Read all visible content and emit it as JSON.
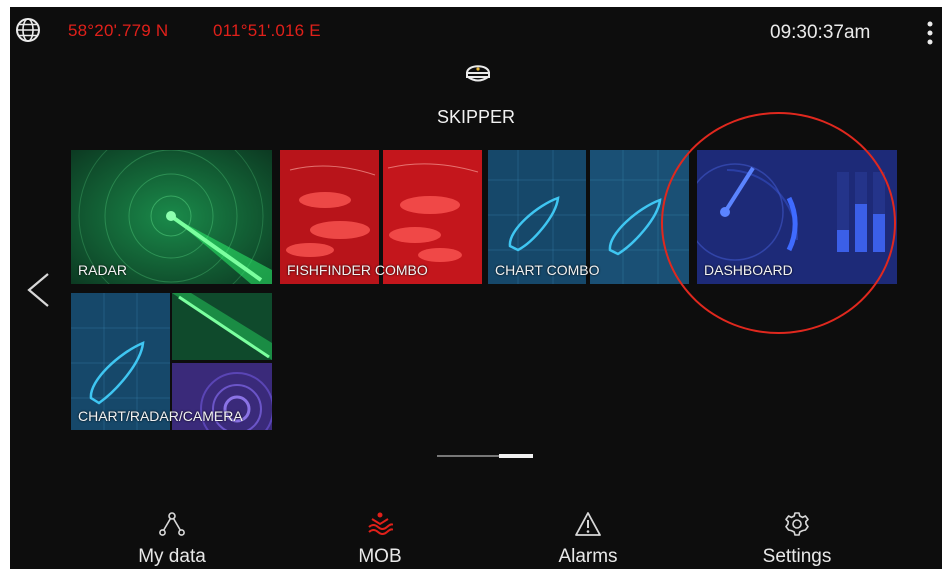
{
  "status_bar": {
    "latitude": "58°20'.779 N",
    "longitude": "011°51'.016 E",
    "time": "09:30:37am"
  },
  "profile": {
    "name": "SKIPPER"
  },
  "tiles": [
    {
      "label": "RADAR"
    },
    {
      "label": "FISHFINDER COMBO"
    },
    {
      "label": "CHART COMBO"
    },
    {
      "label": "DASHBOARD"
    },
    {
      "label": "CHART/RADAR/CAMERA"
    }
  ],
  "bottom_nav": [
    {
      "label": "My data",
      "icon": "my-data-icon"
    },
    {
      "label": "MOB",
      "icon": "mob-icon"
    },
    {
      "label": "Alarms",
      "icon": "alarm-icon"
    },
    {
      "label": "Settings",
      "icon": "settings-icon"
    }
  ],
  "colors": {
    "gps_text": "#e0201a",
    "mob_accent": "#e0201a",
    "radar_green": "#1fd45a",
    "chart_blue": "#2aa9d8",
    "dashboard_blue": "#3a55d8",
    "annotation_circle": "#e0281e"
  },
  "page_indicator": {
    "pages": 2,
    "active": 2
  }
}
